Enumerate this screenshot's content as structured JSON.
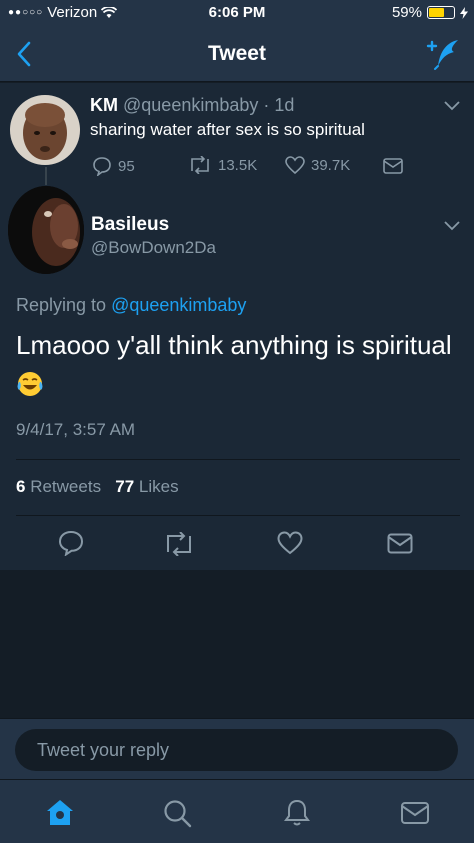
{
  "status": {
    "carrier": "Verizon",
    "time": "6:06 PM",
    "battery": "59%",
    "battery_level": 0.59
  },
  "nav": {
    "title": "Tweet"
  },
  "parent_tweet": {
    "name": "KM",
    "handle": "@queenkimbaby",
    "age": "· 1d",
    "text": "sharing water after sex is so spiritual",
    "replies": "95",
    "retweets": "13.5K",
    "likes": "39.7K"
  },
  "tweet": {
    "name": "Basileus",
    "handle": "@BowDown2Da",
    "replying_prefix": "Replying to",
    "replying_to": "@queenkimbaby",
    "text": "Lmaooo y'all think anything is spiritual",
    "emoji": "😂",
    "date": "9/4/17, 3:57 AM",
    "retweet_count": "6",
    "retweet_label": "Retweets",
    "like_count": "77",
    "like_label": "Likes"
  },
  "reply": {
    "placeholder": "Tweet your reply"
  },
  "tabs": [
    "home-icon",
    "search-icon",
    "notifications-icon",
    "messages-icon"
  ],
  "colors": {
    "accent": "#1da1f2",
    "muted": "#8899a6",
    "bg": "#141d26",
    "panel": "#243447"
  }
}
